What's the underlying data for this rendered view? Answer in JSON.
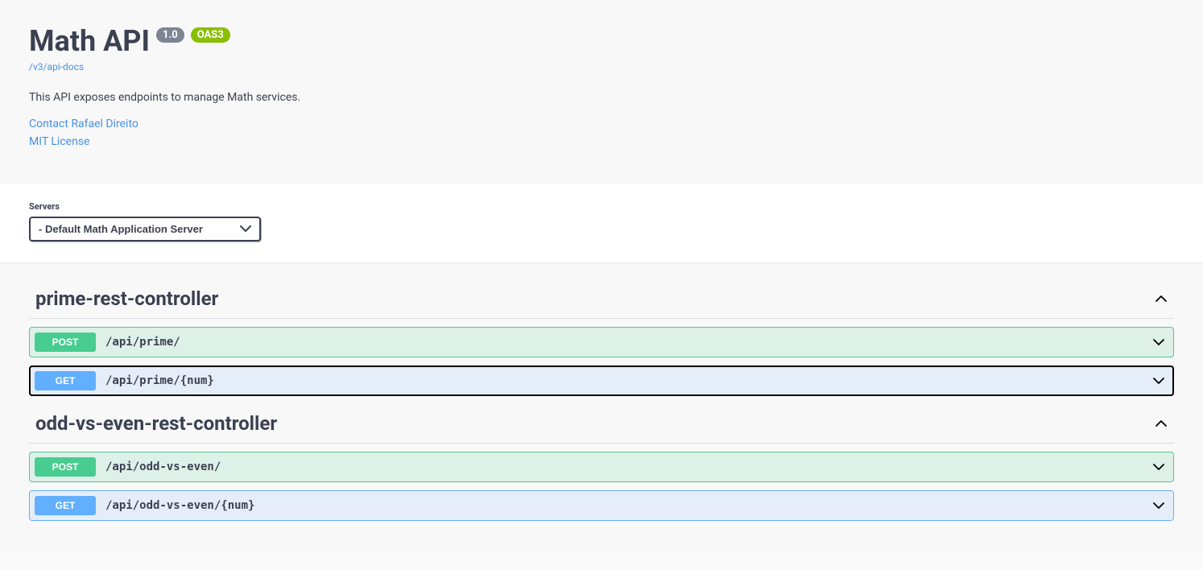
{
  "info": {
    "title": "Math API",
    "version": "1.0",
    "oas_badge": "OAS3",
    "docs_link": "/v3/api-docs",
    "description": "This API exposes endpoints to manage Math services.",
    "contact": "Contact Rafael Direito",
    "license": "MIT License"
  },
  "servers": {
    "label": "Servers",
    "selected": " - Default Math Application Server"
  },
  "tags": [
    {
      "name": "prime-rest-controller",
      "expanded": true,
      "operations": [
        {
          "method": "POST",
          "path": "/api/prime/",
          "focused": false
        },
        {
          "method": "GET",
          "path": "/api/prime/{num}",
          "focused": true
        }
      ]
    },
    {
      "name": "odd-vs-even-rest-controller",
      "expanded": true,
      "operations": [
        {
          "method": "POST",
          "path": "/api/odd-vs-even/",
          "focused": false
        },
        {
          "method": "GET",
          "path": "/api/odd-vs-even/{num}",
          "focused": false
        }
      ]
    }
  ]
}
